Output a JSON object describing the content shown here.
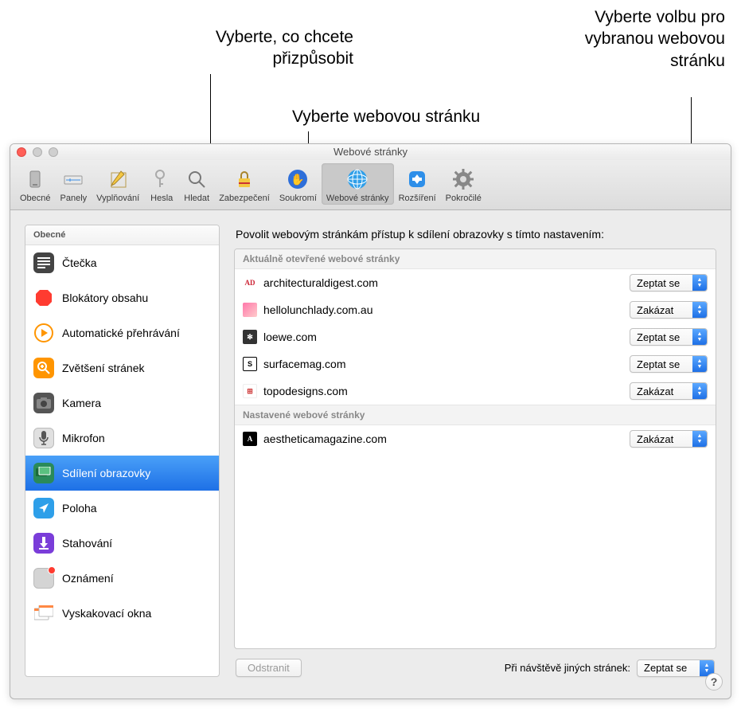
{
  "callouts": {
    "customize": "Vyberte, co chcete přizpůsobit",
    "selectSite": "Vyberte webovou stránku",
    "selectOption": "Vyberte volbu pro vybranou webovou stránku"
  },
  "window": {
    "title": "Webové stránky"
  },
  "toolbar": {
    "items": [
      {
        "label": "Obecné"
      },
      {
        "label": "Panely"
      },
      {
        "label": "Vyplňování"
      },
      {
        "label": "Hesla"
      },
      {
        "label": "Hledat"
      },
      {
        "label": "Zabezpečení"
      },
      {
        "label": "Soukromí"
      },
      {
        "label": "Webové stránky"
      },
      {
        "label": "Rozšíření"
      },
      {
        "label": "Pokročilé"
      }
    ]
  },
  "sidebar": {
    "header": "Obecné",
    "items": [
      {
        "label": "Čtečka"
      },
      {
        "label": "Blokátory obsahu"
      },
      {
        "label": "Automatické přehrávání"
      },
      {
        "label": "Zvětšení stránek"
      },
      {
        "label": "Kamera"
      },
      {
        "label": "Mikrofon"
      },
      {
        "label": "Sdílení obrazovky"
      },
      {
        "label": "Poloha"
      },
      {
        "label": "Stahování"
      },
      {
        "label": "Oznámení"
      },
      {
        "label": "Vyskakovací okna"
      }
    ]
  },
  "main": {
    "heading": "Povolit webovým stránkám přístup k sdílení obrazovky s tímto nastavením:",
    "sectionOpen": "Aktuálně otevřené webové stránky",
    "sectionConfigured": "Nastavené webové stránky",
    "openSites": [
      {
        "name": "architecturaldigest.com",
        "option": "Zeptat se"
      },
      {
        "name": "hellolunchlady.com.au",
        "option": "Zakázat"
      },
      {
        "name": "loewe.com",
        "option": "Zeptat se"
      },
      {
        "name": "surfacemag.com",
        "option": "Zeptat se"
      },
      {
        "name": "topodesigns.com",
        "option": "Zakázat"
      }
    ],
    "configuredSites": [
      {
        "name": "aestheticamagazine.com",
        "option": "Zakázat"
      }
    ],
    "removeButton": "Odstranit",
    "otherSitesLabel": "Při návštěvě jiných stránek:",
    "otherSitesOption": "Zeptat se"
  }
}
